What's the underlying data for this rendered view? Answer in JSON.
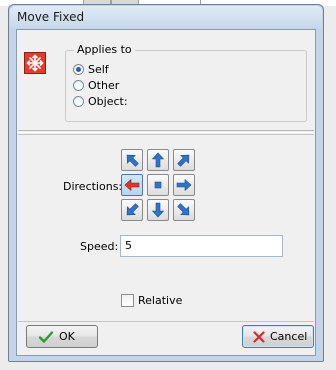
{
  "window": {
    "title": "Move Fixed"
  },
  "applies_to": {
    "legend": "Applies to",
    "options": [
      {
        "label": "Self",
        "checked": true
      },
      {
        "label": "Other",
        "checked": false
      },
      {
        "label": "Object:",
        "checked": false
      }
    ]
  },
  "directions": {
    "label": "Directions:",
    "buttons": [
      {
        "name": "up-left",
        "icon": "arrow-up-left-icon"
      },
      {
        "name": "up",
        "icon": "arrow-up-icon"
      },
      {
        "name": "up-right",
        "icon": "arrow-up-right-icon"
      },
      {
        "name": "left",
        "icon": "arrow-left-icon",
        "pressed": true
      },
      {
        "name": "stop",
        "icon": "stop-square-icon"
      },
      {
        "name": "right",
        "icon": "arrow-right-icon"
      },
      {
        "name": "down-left",
        "icon": "arrow-down-left-icon"
      },
      {
        "name": "down",
        "icon": "arrow-down-icon"
      },
      {
        "name": "down-right",
        "icon": "arrow-down-right-icon"
      }
    ]
  },
  "speed": {
    "label": "Speed:",
    "value": "5"
  },
  "relative": {
    "label": "Relative",
    "checked": false
  },
  "buttons": {
    "ok_label": "OK",
    "cancel_label": "Cancel"
  },
  "colors": {
    "arrow_blue": "#2f74c8",
    "arrow_red": "#d83a2a",
    "icon_red": "#e83a2a",
    "frame_blue": "#c4d5e7"
  }
}
